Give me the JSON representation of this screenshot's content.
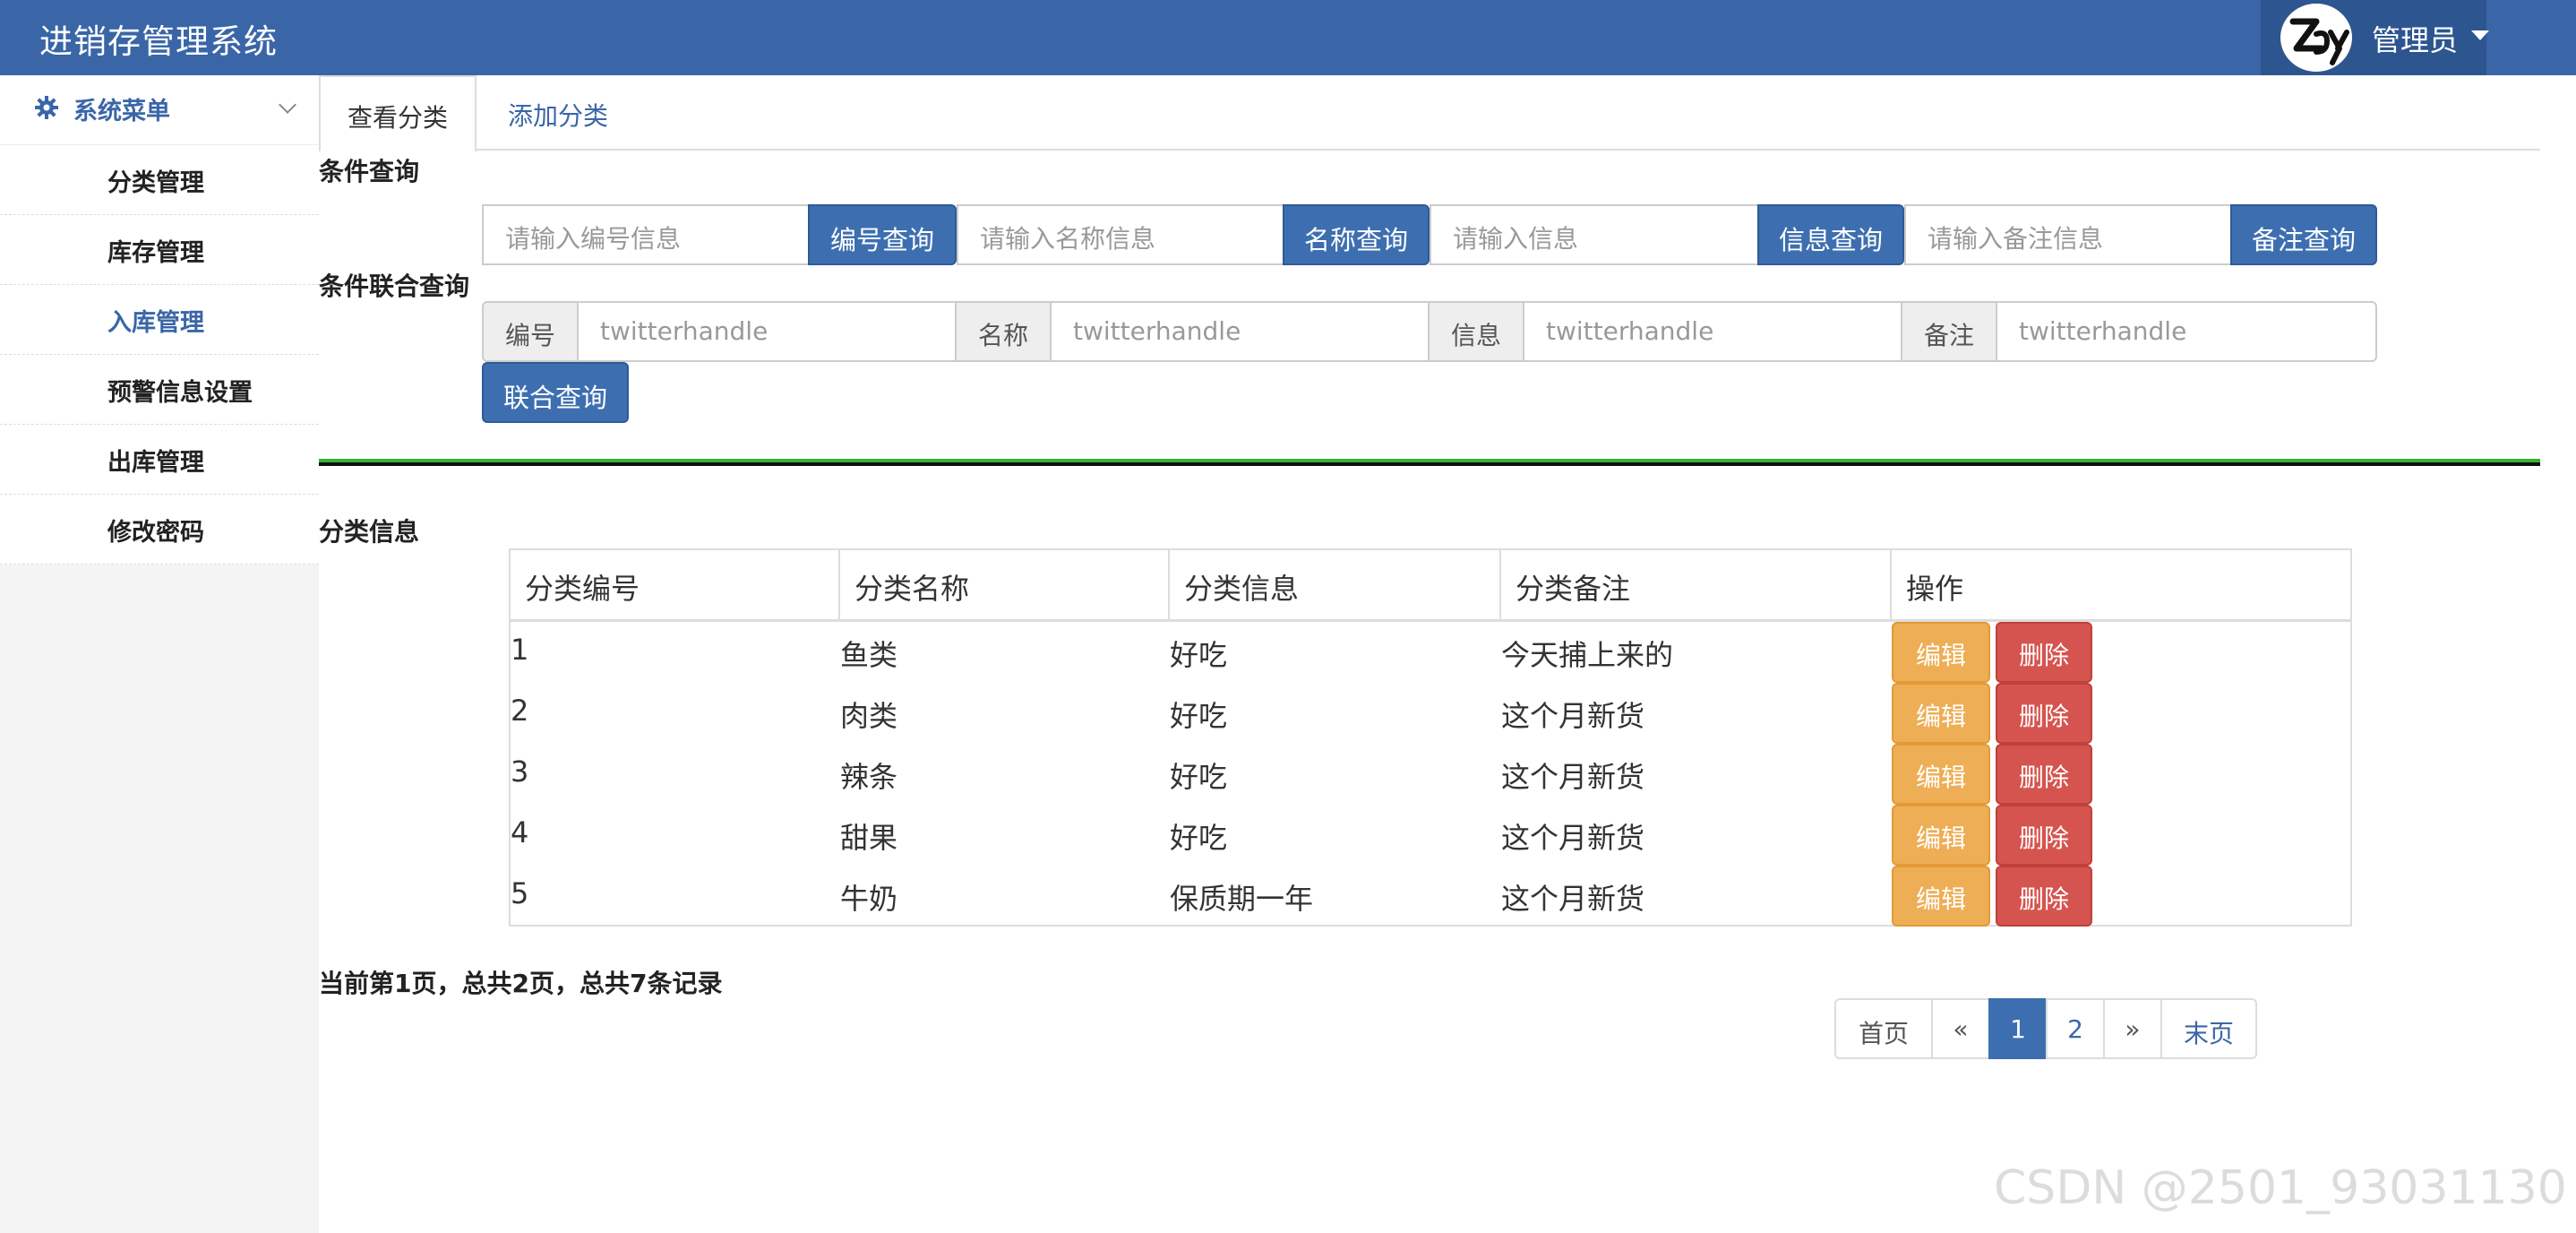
{
  "app": {
    "title": "进销存管理系统"
  },
  "user": {
    "name": "管理员"
  },
  "sidebar": {
    "header": "系统菜单",
    "items": [
      {
        "label": "分类管理",
        "active": false
      },
      {
        "label": "库存管理",
        "active": false
      },
      {
        "label": "入库管理",
        "active": true
      },
      {
        "label": "预警信息设置",
        "active": false
      },
      {
        "label": "出库管理",
        "active": false
      },
      {
        "label": "修改密码",
        "active": false
      }
    ]
  },
  "tabs": [
    {
      "label": "查看分类",
      "active": true
    },
    {
      "label": "添加分类",
      "active": false
    }
  ],
  "query": {
    "title": "条件查询",
    "fields": [
      {
        "placeholder": "请输入编号信息",
        "button": "编号查询"
      },
      {
        "placeholder": "请输入名称信息",
        "button": "名称查询"
      },
      {
        "placeholder": "请输入信息",
        "button": "信息查询"
      },
      {
        "placeholder": "请输入备注信息",
        "button": "备注查询"
      }
    ]
  },
  "union_query": {
    "title": "条件联合查询",
    "fields": [
      {
        "label": "编号",
        "value": "twitterhandle"
      },
      {
        "label": "名称",
        "value": "twitterhandle"
      },
      {
        "label": "信息",
        "value": "twitterhandle"
      },
      {
        "label": "备注",
        "value": "twitterhandle"
      }
    ],
    "button": "联合查询"
  },
  "table": {
    "title": "分类信息",
    "headers": [
      "分类编号",
      "分类名称",
      "分类信息",
      "分类备注",
      "操作"
    ],
    "rows": [
      {
        "id": "1",
        "name": "鱼类",
        "info": "好吃",
        "note": "今天捕上来的"
      },
      {
        "id": "2",
        "name": "肉类",
        "info": "好吃",
        "note": "这个月新货"
      },
      {
        "id": "3",
        "name": "辣条",
        "info": "好吃",
        "note": "这个月新货"
      },
      {
        "id": "4",
        "name": "甜果",
        "info": "好吃",
        "note": "这个月新货"
      },
      {
        "id": "5",
        "name": "牛奶",
        "info": "保质期一年",
        "note": "这个月新货"
      }
    ],
    "edit_label": "编辑",
    "delete_label": "删除"
  },
  "pagination": {
    "info": "当前第1页，总共2页，总共7条记录",
    "first": "首页",
    "prev": "«",
    "pages": [
      "1",
      "2"
    ],
    "current": "1",
    "next": "»",
    "last": "末页"
  },
  "watermark": "CSDN @2501_93031130",
  "colors": {
    "navbar": "#3a66a7",
    "primary": "#3d6fb0",
    "warning": "#eeae55",
    "danger": "#d6544f",
    "divider_green": "#36b336"
  }
}
